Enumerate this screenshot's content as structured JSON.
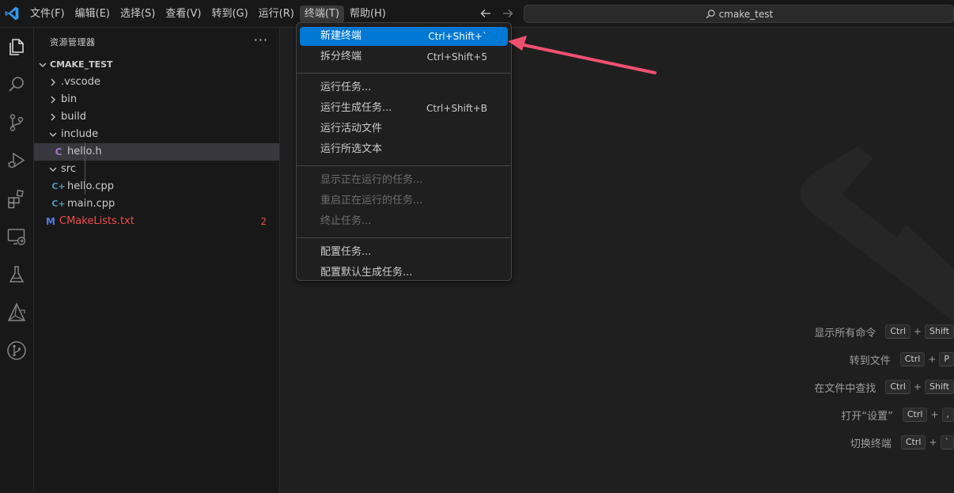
{
  "menubar": {
    "items": [
      "文件(F)",
      "编辑(E)",
      "选择(S)",
      "查看(V)",
      "转到(G)",
      "运行(R)",
      "终端(T)",
      "帮助(H)"
    ],
    "active_index": 6
  },
  "command_center": {
    "text": "cmake_test",
    "icon": "search-icon"
  },
  "activity_bar": {
    "icons": [
      "explorer-icon",
      "search-icon",
      "source-control-icon",
      "run-debug-icon",
      "extensions-icon",
      "remote-explorer-icon",
      "testing-icon",
      "cmake-icon",
      "git-graph-icon"
    ]
  },
  "sidebar": {
    "title": "资源管理器",
    "more": "···",
    "folder": "CMAKE_TEST",
    "tree": [
      {
        "label": ".vscode",
        "type": "folder",
        "expanded": false
      },
      {
        "label": "bin",
        "type": "folder",
        "expanded": false
      },
      {
        "label": "build",
        "type": "folder",
        "expanded": false
      },
      {
        "label": "include",
        "type": "folder",
        "expanded": true
      },
      {
        "label": "hello.h",
        "type": "c-header",
        "icon_text": "C",
        "selected": true
      },
      {
        "label": "src",
        "type": "folder",
        "expanded": true
      },
      {
        "label": "hello.cpp",
        "type": "cpp",
        "icon_text": "C+"
      },
      {
        "label": "main.cpp",
        "type": "cpp",
        "icon_text": "C+"
      },
      {
        "label": "CMakeLists.txt",
        "type": "cmake",
        "icon_text": "M",
        "badge": "2"
      }
    ]
  },
  "terminal_menu": {
    "groups": [
      [
        {
          "label": "新建终端",
          "shortcut": "Ctrl+Shift+`",
          "highlighted": true
        },
        {
          "label": "拆分终端",
          "shortcut": "Ctrl+Shift+5"
        }
      ],
      [
        {
          "label": "运行任务...",
          "shortcut": ""
        },
        {
          "label": "运行生成任务...",
          "shortcut": "Ctrl+Shift+B"
        },
        {
          "label": "运行活动文件",
          "shortcut": ""
        },
        {
          "label": "运行所选文本",
          "shortcut": ""
        }
      ],
      [
        {
          "label": "显示正在运行的任务...",
          "shortcut": "",
          "disabled": true
        },
        {
          "label": "重启正在运行的任务...",
          "shortcut": "",
          "disabled": true
        },
        {
          "label": "终止任务...",
          "shortcut": "",
          "disabled": true
        }
      ],
      [
        {
          "label": "配置任务...",
          "shortcut": ""
        },
        {
          "label": "配置默认生成任务...",
          "shortcut": ""
        }
      ]
    ]
  },
  "editor_shortcuts": [
    {
      "label": "显示所有命令",
      "keys": [
        "Ctrl",
        "Shift"
      ]
    },
    {
      "label": "转到文件",
      "keys": [
        "Ctrl",
        "P"
      ]
    },
    {
      "label": "在文件中查找",
      "keys": [
        "Ctrl",
        "Shift"
      ]
    },
    {
      "label": "打开“设置”",
      "keys": [
        "Ctrl",
        ","
      ]
    },
    {
      "label": "切换终端",
      "keys": [
        "Ctrl",
        "`"
      ]
    }
  ],
  "colors": {
    "accent": "#0078d4",
    "annotation_arrow": "#f0506e",
    "error": "#f14c4c",
    "cpp_icon": "#519aba",
    "c_icon": "#a074c4",
    "cmake_icon": "#4e7de8"
  }
}
